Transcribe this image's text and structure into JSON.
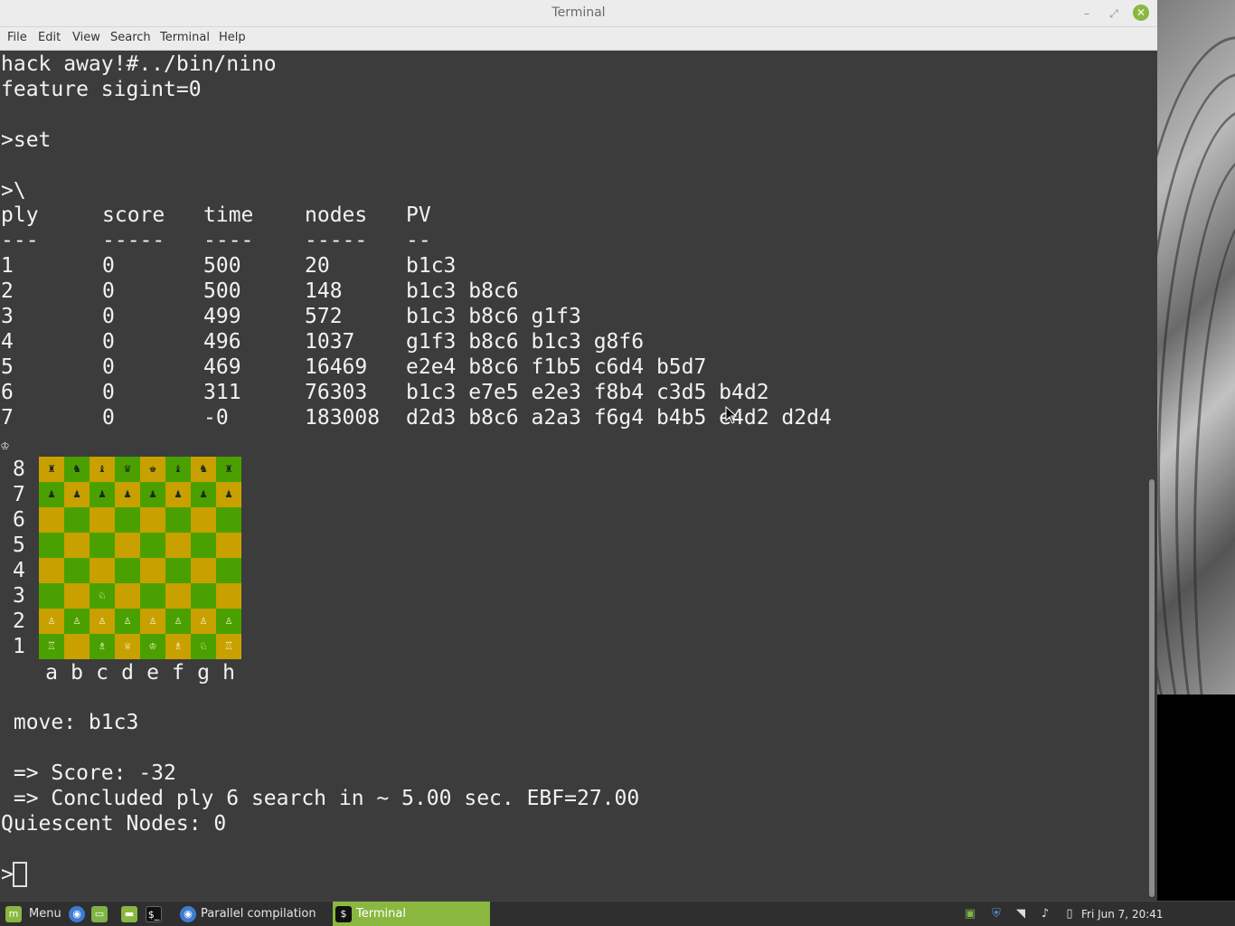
{
  "window": {
    "title": "Terminal",
    "minimize_glyph": "–",
    "maximize_glyph": "⤢",
    "close_glyph": "✕"
  },
  "menu": [
    "File",
    "Edit",
    "View",
    "Search",
    "Terminal",
    "Help"
  ],
  "terminal": {
    "lines_top": [
      "hack away!#../bin/nino",
      "feature sigint=0",
      "",
      ">set",
      "",
      ">\\"
    ],
    "table_header": [
      "ply",
      "score",
      "time",
      "nodes",
      "PV"
    ],
    "table_rule": [
      "---",
      "-----",
      "----",
      "-----",
      "--"
    ],
    "table_rows": [
      [
        "1",
        "0",
        "500",
        "20",
        "b1c3"
      ],
      [
        "2",
        "0",
        "500",
        "148",
        "b1c3 b8c6"
      ],
      [
        "3",
        "0",
        "499",
        "572",
        "b1c3 b8c6 g1f3"
      ],
      [
        "4",
        "0",
        "496",
        "1037",
        "g1f3 b8c6 b1c3 g8f6"
      ],
      [
        "5",
        "0",
        "469",
        "16469",
        "e2e4 b8c6 f1b5 c6d4 b5d7"
      ],
      [
        "6",
        "0",
        "311",
        "76303",
        "b1c3 e7e5 e2e3 f8b4 c3d5 b4d2"
      ],
      [
        "7",
        "0",
        "-0",
        "183008",
        "d2d3 b8c6 a2a3 f6g4 b4b5 e4d2 d2d4"
      ]
    ],
    "side_to_move_glyph": "♔",
    "board": {
      "ranks": [
        "8",
        "7",
        "6",
        "5",
        "4",
        "3",
        "2",
        "1"
      ],
      "files": [
        "a",
        "b",
        "c",
        "d",
        "e",
        "f",
        "g",
        "h"
      ],
      "rows": [
        [
          "♜",
          "♞",
          "♝",
          "♛",
          "♚",
          "♝",
          "♞",
          "♜"
        ],
        [
          "♟",
          "♟",
          "♟",
          "♟",
          "♟",
          "♟",
          "♟",
          "♟"
        ],
        [
          "",
          "",
          "",
          "",
          "",
          "",
          "",
          ""
        ],
        [
          "",
          "",
          "",
          "",
          "",
          "",
          "",
          ""
        ],
        [
          "",
          "",
          "",
          "",
          "",
          "",
          "",
          ""
        ],
        [
          "",
          "",
          "♘",
          "",
          "",
          "",
          "",
          ""
        ],
        [
          "♙",
          "♙",
          "♙",
          "♙",
          "♙",
          "♙",
          "♙",
          "♙"
        ],
        [
          "♖",
          "",
          "♗",
          "♕",
          "♔",
          "♗",
          "♘",
          "♖"
        ]
      ],
      "light_color": "#c8a000",
      "dark_color": "#4aa000"
    },
    "lines_bottom": [
      " move: b1c3",
      "",
      " => Score: -32",
      " => Concluded ply 6 search in ~ 5.00 sec. EBF=27.00",
      "Quiescent Nodes: 0",
      "",
      ">"
    ]
  },
  "taskbar": {
    "menu_label": "Menu",
    "tasks": [
      {
        "label": "Parallel compilation fro...",
        "icon": "chrome-icon"
      },
      {
        "label": "Terminal",
        "icon": "terminal-icon"
      }
    ],
    "clock": "Fri Jun  7, 20:41"
  },
  "colors": {
    "accent": "#8ab740",
    "terminal_bg": "#3c3c3c",
    "terminal_fg": "#f2f2f2"
  }
}
